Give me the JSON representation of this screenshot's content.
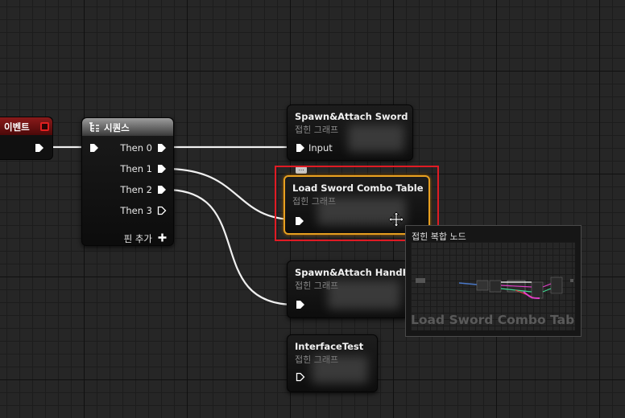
{
  "colors": {
    "exec_wire": "#f0f0f0",
    "event_header": "#8a1a1a",
    "selection_highlight": "#e01b24",
    "selected_node_border": "#e8a020"
  },
  "event_node": {
    "title": "이벤트"
  },
  "sequence_node": {
    "icon": "sequence-icon",
    "title": "시퀀스",
    "outputs": [
      "Then 0",
      "Then 1",
      "Then 2",
      "Then 3"
    ],
    "add_pin": "핀 추가",
    "add_pin_icon": "plus-icon"
  },
  "nodes": [
    {
      "title": "Spawn&Attach Sword",
      "subtitle": "접힌 그래프",
      "input_label": "Input"
    },
    {
      "title": "Load Sword Combo Table",
      "subtitle": "접힌 그래프"
    },
    {
      "title": "Spawn&Attach HandFire",
      "subtitle": "접힌 그래프"
    },
    {
      "title": "InterfaceTest",
      "subtitle": "접힌 그래프"
    }
  ],
  "tooltip": {
    "title": "접힌 복합 노드",
    "caption": "Load Sword Combo Table"
  },
  "cursor": "move-cursor-icon"
}
